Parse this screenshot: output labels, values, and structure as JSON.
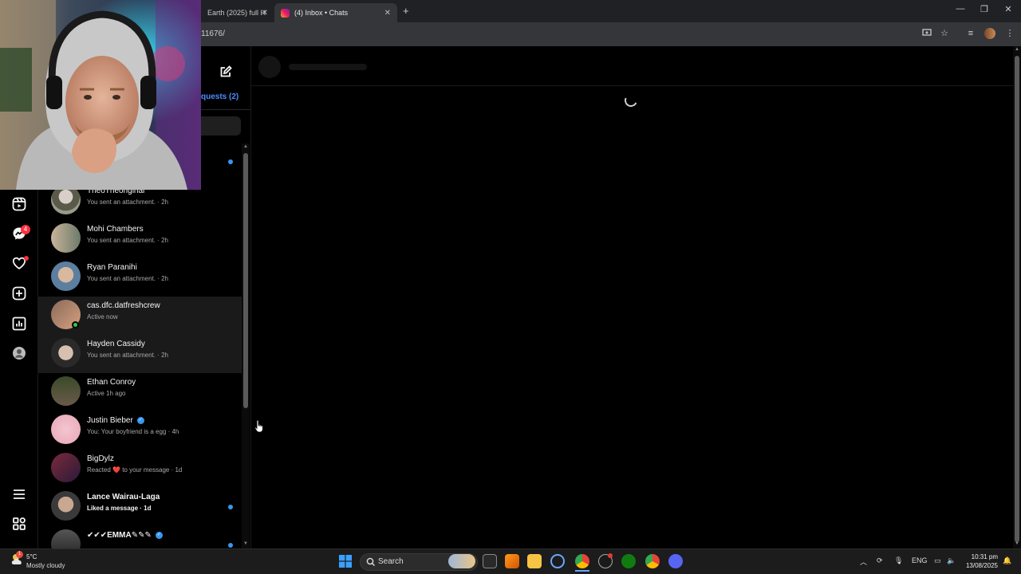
{
  "browser": {
    "tabs": [
      {
        "label": "Earth (2025) full H",
        "active": false
      },
      {
        "label": "(4) Inbox • Chats",
        "active": true
      }
    ],
    "new_tab_label": "+",
    "url": "11676/"
  },
  "nav": {
    "messages_badge": "4"
  },
  "chats": {
    "requests_label": "quests (2)",
    "items": [
      {
        "name": "TheoTheoriginal",
        "sub": "You sent an attachment. · 2h",
        "bold": false,
        "online": false,
        "verified": false,
        "unread": false,
        "highlight": false
      },
      {
        "name": "Mohi Chambers",
        "sub": "You sent an attachment. · 2h",
        "bold": false,
        "online": false,
        "verified": false,
        "unread": false,
        "highlight": false
      },
      {
        "name": "Ryan Paranihi",
        "sub": "You sent an attachment. · 2h",
        "bold": false,
        "online": false,
        "verified": false,
        "unread": false,
        "highlight": false
      },
      {
        "name": "cas.dfc.datfreshcrew",
        "sub": "Active now",
        "bold": false,
        "online": true,
        "verified": false,
        "unread": false,
        "highlight": true
      },
      {
        "name": "Hayden Cassidy",
        "sub": "You sent an attachment. · 2h",
        "bold": false,
        "online": false,
        "verified": false,
        "unread": false,
        "highlight": true
      },
      {
        "name": "Ethan Conroy",
        "sub": "Active 1h ago",
        "bold": false,
        "online": false,
        "verified": false,
        "unread": false,
        "highlight": false
      },
      {
        "name": "Justin Bieber",
        "sub": "You: Your boyfriend is a egg · 4h",
        "bold": false,
        "online": false,
        "verified": true,
        "unread": false,
        "highlight": false
      },
      {
        "name": "BigDylz",
        "sub": "Reacted ❤️ to your message · 1d",
        "bold": false,
        "online": false,
        "verified": false,
        "unread": false,
        "highlight": false
      },
      {
        "name": "Lance Wairau-Laga",
        "sub": "Liked a message · 1d",
        "bold": true,
        "online": false,
        "verified": false,
        "unread": true,
        "highlight": false
      },
      {
        "name": "✔✔✔EMMA✎✎✎",
        "sub": "",
        "bold": true,
        "online": false,
        "verified": true,
        "unread": true,
        "highlight": false
      }
    ]
  },
  "taskbar": {
    "weather_temp": "5°C",
    "weather_desc": "Mostly cloudy",
    "weather_badge": "1",
    "search_label": "Search",
    "language": "ENG",
    "time": "10:31 pm",
    "date": "13/08/2025"
  },
  "colors": {
    "accent_blue": "#3897f0",
    "link_blue": "#4a8cff",
    "badge_red": "#ff3040",
    "online_green": "#2ecc40"
  }
}
